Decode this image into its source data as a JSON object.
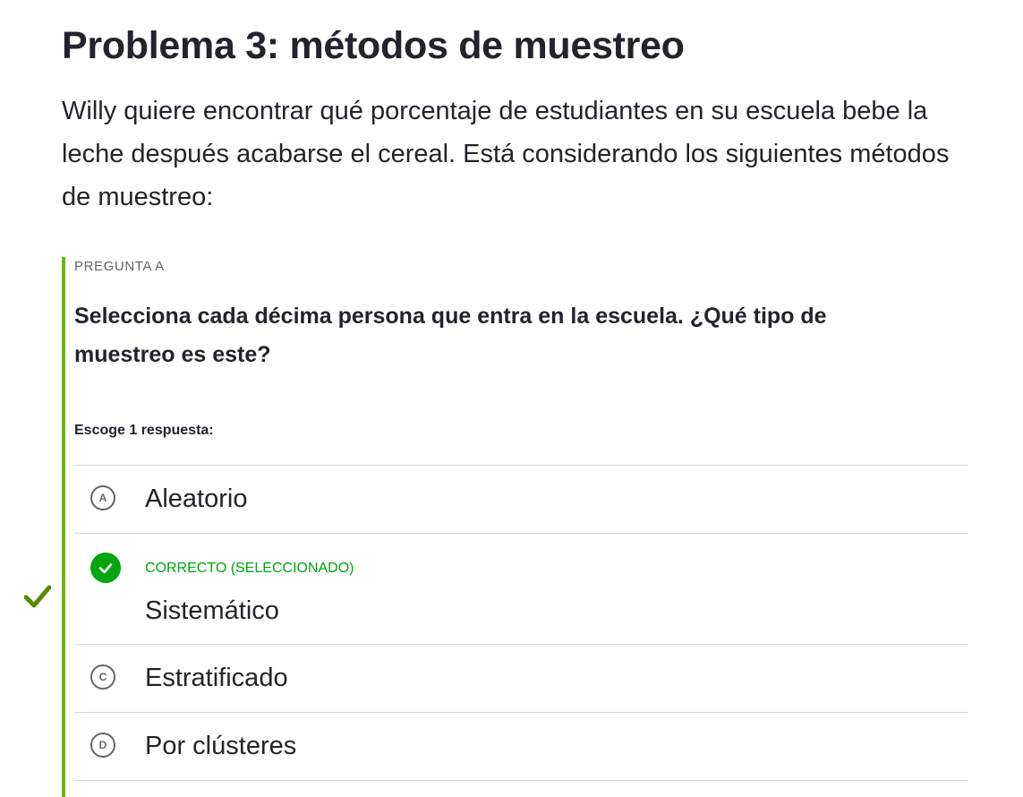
{
  "page": {
    "title": "Problema 3: métodos de muestreo",
    "intro": "Willy quiere encontrar qué porcentaje de estudiantes en su escuela bebe la leche después acabarse el cereal. Está considerando los siguientes métodos de muestreo:"
  },
  "question": {
    "label": "PREGUNTA A",
    "text": "Selecciona cada décima persona que entra en la escuela. ¿Qué tipo de muestreo es este?",
    "instructions": "Escoge 1 respuesta:",
    "status": "correct"
  },
  "choices": [
    {
      "letter": "A",
      "text": "Aleatorio",
      "state": "unselected"
    },
    {
      "status_label": "CORRECTO (SELECCIONADO)",
      "text": "Sistemático",
      "state": "correct-selected"
    },
    {
      "letter": "C",
      "text": "Estratificado",
      "state": "unselected"
    },
    {
      "letter": "D",
      "text": "Por clústeres",
      "state": "unselected"
    }
  ],
  "icons": {
    "side_marker": "checkmark-icon",
    "selected_bubble": "check-circle-icon"
  },
  "colors": {
    "correct_green": "#00a60e",
    "side_check_olive": "#5a8a00",
    "question_border": "#71b307",
    "text": "#21242c",
    "muted": "#626569",
    "divider": "#d6d8da"
  }
}
